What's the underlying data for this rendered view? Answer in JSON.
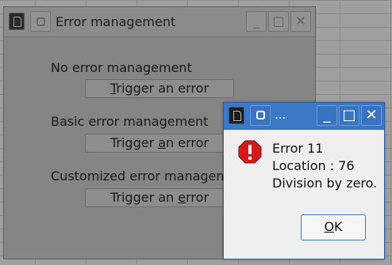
{
  "main_window": {
    "title": "Error management",
    "sections": [
      {
        "label": "No error management",
        "button": {
          "pre": "",
          "mnemonic": "T",
          "post": "rigger an error"
        }
      },
      {
        "label": "Basic error management",
        "button": {
          "pre": "Trigger ",
          "mnemonic": "a",
          "post": "n error"
        }
      },
      {
        "label": "Customized error management",
        "button": {
          "pre": "Trigger an ",
          "mnemonic": "e",
          "post": "rror"
        }
      }
    ]
  },
  "error_dialog": {
    "title": "...",
    "lines": [
      "Error 11",
      "Location : 76",
      "Division by zero."
    ],
    "ok_mnemonic": "O",
    "ok_rest": "K",
    "icon": "stop-icon",
    "accent": "#3b78c6",
    "icon_color": "#d11a1a"
  },
  "window_controls": {
    "minimize": "_",
    "maximize": "□",
    "close": "✕"
  }
}
